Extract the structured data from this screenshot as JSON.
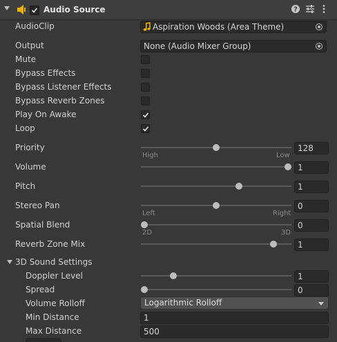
{
  "component": {
    "title": "Audio Source",
    "enabled": true
  },
  "fields": {
    "audio_clip_label": "AudioClip",
    "audio_clip_value": "Aspiration Woods (Area Theme)",
    "output_label": "Output",
    "output_value": "None (Audio Mixer Group)",
    "mute_label": "Mute",
    "mute_checked": false,
    "bypass_effects_label": "Bypass Effects",
    "bypass_effects_checked": false,
    "bypass_listener_label": "Bypass Listener Effects",
    "bypass_listener_checked": false,
    "bypass_reverb_label": "Bypass Reverb Zones",
    "bypass_reverb_checked": false,
    "play_on_awake_label": "Play On Awake",
    "play_on_awake_checked": true,
    "loop_label": "Loop",
    "loop_checked": true
  },
  "sliders": {
    "priority": {
      "label": "Priority",
      "value": "128",
      "min_caption": "High",
      "max_caption": "Low",
      "fraction": 0.5
    },
    "volume": {
      "label": "Volume",
      "value": "1",
      "fraction": 1.0
    },
    "pitch": {
      "label": "Pitch",
      "value": "1",
      "fraction": 0.66
    },
    "stereo_pan": {
      "label": "Stereo Pan",
      "value": "0",
      "min_caption": "Left",
      "max_caption": "Right",
      "fraction": 0.5
    },
    "spatial_blend": {
      "label": "Spatial Blend",
      "value": "0",
      "min_caption": "2D",
      "max_caption": "3D",
      "fraction": 0.0
    },
    "reverb_zone_mix": {
      "label": "Reverb Zone Mix",
      "value": "1",
      "fraction": 0.9
    }
  },
  "sound3d": {
    "section_label": "3D Sound Settings",
    "doppler_level": {
      "label": "Doppler Level",
      "value": "1",
      "fraction": 0.2
    },
    "spread": {
      "label": "Spread",
      "value": "0",
      "fraction": 0.0
    },
    "volume_rolloff_label": "Volume Rolloff",
    "volume_rolloff_value": "Logarithmic Rolloff",
    "min_distance_label": "Min Distance",
    "min_distance_value": "1",
    "max_distance_label": "Max Distance",
    "max_distance_value": "500"
  },
  "icons": {
    "component": "audio-speaker-icon",
    "help": "help-icon",
    "presets": "sliders-icon",
    "menu": "kebab-menu-icon"
  },
  "colors": {
    "panel_bg": "#383838",
    "field_bg": "#2a2a2a",
    "speaker_accent": "#f0b400"
  }
}
